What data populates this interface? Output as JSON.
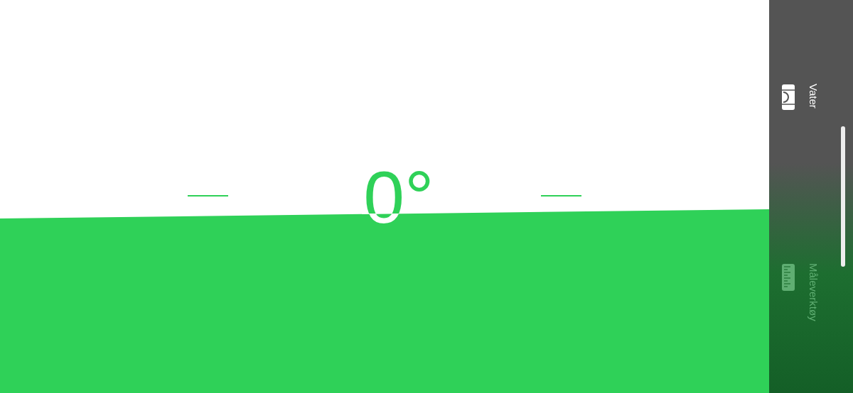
{
  "reading": {
    "text": "0°"
  },
  "tools": [
    {
      "kind": "level",
      "label": "Vater",
      "selected": true
    },
    {
      "kind": "ruler",
      "label": "Måleverktøy",
      "selected": false
    }
  ]
}
